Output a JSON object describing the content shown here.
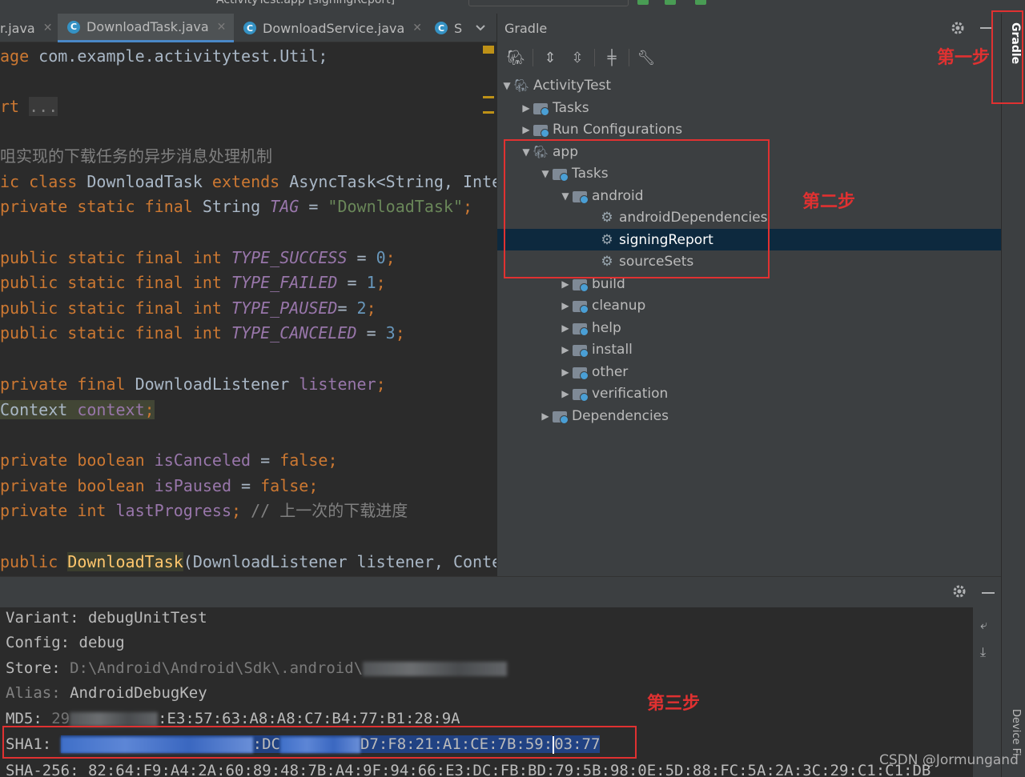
{
  "topbar": {
    "config_text": "ActivityTest.app [signingReport]"
  },
  "tabs": [
    {
      "label": "r.java"
    },
    {
      "label": "DownloadTask.java"
    },
    {
      "label": "DownloadService.java"
    },
    {
      "label": "S"
    }
  ],
  "editor": {
    "line1": {
      "kw": "age",
      "text": " com.example.activitytest.Util;"
    },
    "line2": {
      "kw": "rt",
      "fold": "..."
    },
    "line3": {
      "comment": "咀实现的下载任务的异步消息处理机制"
    },
    "line4": {
      "kw1": "ic class",
      "name": " DownloadTask ",
      "kw2": "extends",
      "rest": " AsyncTask<String, Inte"
    },
    "line5": {
      "kw": "private static final",
      "type": " String ",
      "field": "TAG",
      "eq": " = ",
      "str": "\"DownloadTask\"",
      "semi": ";"
    },
    "line6": {
      "kw": "public static final int",
      "field": "TYPE_SUCCESS",
      "eq": " = ",
      "num": "0",
      "semi": ";"
    },
    "line7": {
      "kw": "public static final int",
      "field": "TYPE_FAILED",
      "eq": " = ",
      "num": "1",
      "semi": ";"
    },
    "line8": {
      "kw": "public static final int",
      "field": "TYPE_PAUSED",
      "eq": "= ",
      "num": "2",
      "semi": ";"
    },
    "line9": {
      "kw": "public static final int",
      "field": "TYPE_CANCELED",
      "eq": " = ",
      "num": "3",
      "semi": ";"
    },
    "line10": {
      "kw": "private final",
      "type": " DownloadListener ",
      "field": "listener",
      "semi": ";"
    },
    "line11": {
      "type": "Context ",
      "field": "context",
      "semi": ";"
    },
    "line12": {
      "kw": "private boolean",
      "field": "isCanceled",
      "eq": " = ",
      "val": "false",
      "semi": ";"
    },
    "line13": {
      "kw": "private boolean",
      "field": "isPaused",
      "eq": " = ",
      "val": "false",
      "semi": ";"
    },
    "line14": {
      "kw": "private int",
      "field": "lastProgress",
      "semi": ";",
      "comment": " // 上一次的下载进度"
    },
    "line15": {
      "kw": "public",
      "fn": "DownloadTask",
      "rest": "(DownloadListener listener, Conte"
    }
  },
  "gradle": {
    "title": "Gradle",
    "tree": [
      {
        "label": "ActivityTest"
      },
      {
        "label": "Tasks"
      },
      {
        "label": "Run Configurations"
      },
      {
        "label": "app"
      },
      {
        "label": "Tasks"
      },
      {
        "label": "android"
      },
      {
        "label": "androidDependencies"
      },
      {
        "label": "signingReport"
      },
      {
        "label": "sourceSets"
      },
      {
        "label": "build"
      },
      {
        "label": "cleanup"
      },
      {
        "label": "help"
      },
      {
        "label": "install"
      },
      {
        "label": "other"
      },
      {
        "label": "verification"
      },
      {
        "label": "Dependencies"
      }
    ],
    "selected": "signingReport"
  },
  "sidebar": {
    "gradle_label": "Gradle",
    "device_label": "Device Fi"
  },
  "console": {
    "variant": "Variant: debugUnitTest",
    "config": "Config: debug",
    "store_prefix": "Store: ",
    "store_rest": "D:\\Android\\Android\\Sdk\\.android\\",
    "alias_prefix": "Alias: ",
    "alias_rest": "AndroidDebugKey",
    "md5_prefix": "MD5: ",
    "md5_start": "29",
    "md5_end": ":E3:57:63:A8:A8:C7:B4:77:B1:28:9A",
    "sha1_prefix": "SHA1: ",
    "sha1_mid": ":DC",
    "sha1_end_a": "D7:F8:21:A1:CE:7B:59:",
    "sha1_end_b": "03:77",
    "sha256": "SHA-256: 82:64:F9:A4:2A:60:89:48:7B:A4:9F:94:66:E3:DC:FB:BD:79:5B:98:0E:5D:88:FC:5A:2A:3C:29:C1:C1:DB"
  },
  "annotations": {
    "step1": "第一步",
    "step2": "第二步",
    "step3": "第三步",
    "color": "#e03131"
  },
  "watermark": "CSDN @Jormungand"
}
